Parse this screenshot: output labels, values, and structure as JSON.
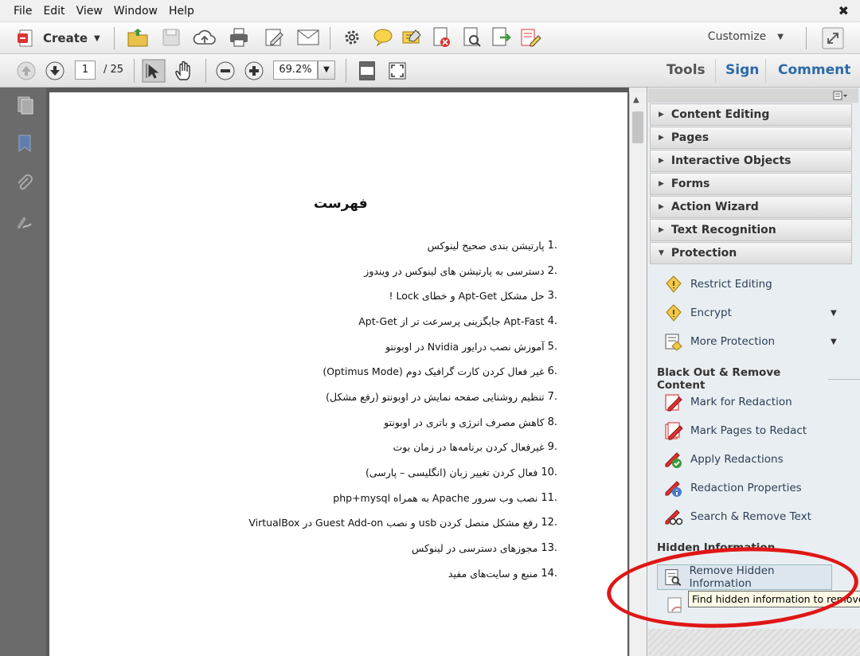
{
  "menu": [
    "File",
    "Edit",
    "View",
    "Window",
    "Help"
  ],
  "toolbar": {
    "create_label": "Create",
    "customize_label": "Customize",
    "close_glyph": "✖"
  },
  "nav": {
    "page_current": "1",
    "page_total": "/ 25",
    "zoom": "69.2%"
  },
  "right_nav": {
    "tools": "Tools",
    "sign": "Sign",
    "comment": "Comment"
  },
  "document": {
    "title": "فهرست",
    "items": [
      {
        "num": ".1",
        "text": "پارتیشن بندی صحیح  لینوکس"
      },
      {
        "num": ".2",
        "text": "دسترسی به پارتیشن های لینوکس در ویندوز"
      },
      {
        "num": ".3",
        "text": "حل مشکل Apt-Get و خطای Lock !"
      },
      {
        "num": ".4",
        "text": "Apt-Fast جایگزینی پرسرعت تر از Apt-Get"
      },
      {
        "num": ".5",
        "text": "آموزش نصب درایور Nvidia در اوبونتو"
      },
      {
        "num": ".6",
        "text": "غیر فعال کردن کارت گرافیک دوم (Optimus Mode)"
      },
      {
        "num": ".7",
        "text": "تنظیم روشنایی صفحه نمایش در اوبونتو (رفع مشکل)"
      },
      {
        "num": ".8",
        "text": "کاهش مصرف انرژی و باتری در اوبونتو"
      },
      {
        "num": ".9",
        "text": "غیرفعال کردن برنامه‌ها در زمان بوت"
      },
      {
        "num": ".10",
        "text": "فعال کردن تغییر زبان (انگلیسی – پارسی)"
      },
      {
        "num": ".11",
        "text": "نصب وب سرور Apache به همراه php+mysql"
      },
      {
        "num": ".12",
        "text": "رفع مشکل متصل کردن usb و نصب Guest Add-on در VirtualBox"
      },
      {
        "num": ".13",
        "text": "مجوزهای دسترسی در لینوکس"
      },
      {
        "num": ".14",
        "text": "منبع و سایت‌های مفید"
      }
    ]
  },
  "panel": {
    "sections": [
      {
        "label": "Content Editing",
        "open": false
      },
      {
        "label": "Pages",
        "open": false
      },
      {
        "label": "Interactive Objects",
        "open": false
      },
      {
        "label": "Forms",
        "open": false
      },
      {
        "label": "Action Wizard",
        "open": false
      },
      {
        "label": "Text Recognition",
        "open": false
      },
      {
        "label": "Protection",
        "open": true
      }
    ],
    "protection_tools": [
      {
        "label": "Restrict Editing",
        "icon": "shield-icon"
      },
      {
        "label": "Encrypt",
        "icon": "shield-icon"
      },
      {
        "label": "More Protection",
        "icon": "shield-key-icon"
      }
    ],
    "blackout_header": "Black Out & Remove Content",
    "blackout_tools": [
      {
        "label": "Mark for Redaction",
        "icon": "redaction-pen-icon"
      },
      {
        "label": "Mark Pages to Redact",
        "icon": "redaction-pages-icon"
      },
      {
        "label": "Apply Redactions",
        "icon": "apply-redaction-icon"
      },
      {
        "label": "Redaction Properties",
        "icon": "redaction-properties-icon"
      },
      {
        "label": "Search & Remove Text",
        "icon": "search-remove-icon"
      }
    ],
    "hidden_header": "Hidden Information",
    "hidden_tools": [
      {
        "label": "Remove Hidden Information",
        "icon": "remove-hidden-icon"
      }
    ],
    "tooltip": "Find hidden information to remove"
  },
  "colors": {
    "accent": "#2c6aa8",
    "highlight": "#e01616"
  }
}
